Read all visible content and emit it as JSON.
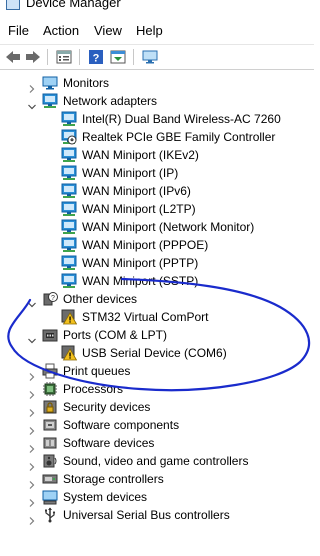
{
  "window": {
    "title": "Device Manager"
  },
  "menu": [
    "File",
    "Action",
    "View",
    "Help"
  ],
  "toolbar": [
    {
      "name": "back-arrow-icon"
    },
    {
      "name": "forward-arrow-icon"
    },
    {
      "name": "properties-icon"
    },
    {
      "name": "help-icon"
    },
    {
      "name": "show-hidden-icon"
    },
    {
      "name": "monitor-scan-icon"
    }
  ],
  "tree": [
    {
      "label": "Monitors",
      "level": 1,
      "expander": "collapsed",
      "icon": "monitor-icon"
    },
    {
      "label": "Network adapters",
      "level": 1,
      "expander": "expanded",
      "icon": "network-adapter-icon"
    },
    {
      "label": "Intel(R) Dual Band Wireless-AC 7260",
      "level": 2,
      "icon": "network-adapter-icon"
    },
    {
      "label": "Realtek PCIe GBE Family Controller",
      "level": 2,
      "icon": "network-adapter-disabled-icon"
    },
    {
      "label": "WAN Miniport (IKEv2)",
      "level": 2,
      "icon": "network-adapter-icon"
    },
    {
      "label": "WAN Miniport (IP)",
      "level": 2,
      "icon": "network-adapter-icon"
    },
    {
      "label": "WAN Miniport (IPv6)",
      "level": 2,
      "icon": "network-adapter-icon"
    },
    {
      "label": "WAN Miniport (L2TP)",
      "level": 2,
      "icon": "network-adapter-icon"
    },
    {
      "label": "WAN Miniport (Network Monitor)",
      "level": 2,
      "icon": "network-adapter-icon"
    },
    {
      "label": "WAN Miniport (PPPOE)",
      "level": 2,
      "icon": "network-adapter-icon"
    },
    {
      "label": "WAN Miniport (PPTP)",
      "level": 2,
      "icon": "network-adapter-icon"
    },
    {
      "label": "WAN Miniport (SSTP)",
      "level": 2,
      "icon": "network-adapter-icon"
    },
    {
      "label": "Other devices",
      "level": 1,
      "expander": "expanded",
      "icon": "unknown-device-icon"
    },
    {
      "label": "STM32 Virtual ComPort",
      "level": 2,
      "icon": "warning-device-icon"
    },
    {
      "label": "Ports (COM & LPT)",
      "level": 1,
      "expander": "expanded",
      "icon": "port-icon"
    },
    {
      "label": "USB Serial Device (COM6)",
      "level": 2,
      "icon": "warning-device-icon"
    },
    {
      "label": "Print queues",
      "level": 1,
      "expander": "collapsed",
      "icon": "printer-icon"
    },
    {
      "label": "Processors",
      "level": 1,
      "expander": "collapsed",
      "icon": "processor-icon"
    },
    {
      "label": "Security devices",
      "level": 1,
      "expander": "collapsed",
      "icon": "security-device-icon"
    },
    {
      "label": "Software components",
      "level": 1,
      "expander": "collapsed",
      "icon": "software-component-icon"
    },
    {
      "label": "Software devices",
      "level": 1,
      "expander": "collapsed",
      "icon": "software-device-icon"
    },
    {
      "label": "Sound, video and game controllers",
      "level": 1,
      "expander": "collapsed",
      "icon": "speaker-icon"
    },
    {
      "label": "Storage controllers",
      "level": 1,
      "expander": "collapsed",
      "icon": "storage-controller-icon"
    },
    {
      "label": "System devices",
      "level": 1,
      "expander": "collapsed",
      "icon": "system-device-icon"
    },
    {
      "label": "Universal Serial Bus controllers",
      "level": 1,
      "expander": "collapsed",
      "icon": "usb-icon"
    }
  ],
  "colors": {
    "annotation": "#1a2bcc",
    "icon_blue": "#2a8fd6",
    "warning": "#f2c01e"
  }
}
